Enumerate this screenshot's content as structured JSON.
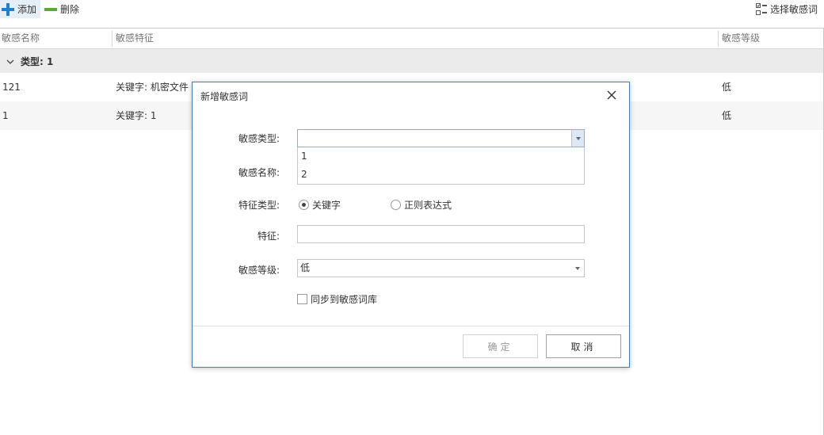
{
  "toolbar": {
    "add_label": "添加",
    "delete_label": "删除",
    "select_words_label": "选择敏感词"
  },
  "grid": {
    "columns": [
      "敏感名称",
      "敏感特征",
      "敏感等级"
    ],
    "group_label": "类型: 1",
    "rows": [
      {
        "name": "121",
        "feature": "关键字: 机密文件",
        "level": "低"
      },
      {
        "name": "1",
        "feature": "关键字: 1",
        "level": "低"
      }
    ]
  },
  "dialog": {
    "title": "新增敏感词",
    "labels": {
      "type": "敏感类型:",
      "name": "敏感名称:",
      "feature_type": "特征类型:",
      "feature": "特征:",
      "level": "敏感等级:"
    },
    "type_value": "",
    "type_options": [
      "1",
      "2"
    ],
    "feature_type_options": [
      {
        "label": "关键字",
        "selected": true
      },
      {
        "label": "正则表达式",
        "selected": false
      }
    ],
    "feature_value": "",
    "level_value": "低",
    "sync_label": "同步到敏感词库",
    "sync_checked": false,
    "ok_label": "确定",
    "cancel_label": "取消"
  },
  "colors": {
    "add_icon": "#1f7fd4",
    "delete_icon": "#58a83b",
    "dialog_border": "#3f7fc0"
  }
}
